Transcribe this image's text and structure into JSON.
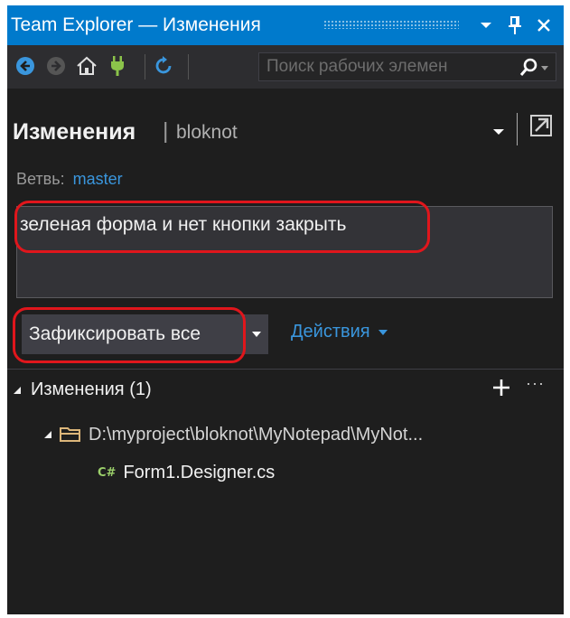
{
  "titlebar": {
    "title": "Team Explorer — Изменения",
    "icons": [
      "dropdown-icon",
      "pin-icon",
      "close-icon"
    ]
  },
  "toolbar": {
    "icons": [
      "back-icon",
      "forward-icon",
      "home-icon",
      "connect-icon",
      "refresh-icon"
    ],
    "search_placeholder": "Поиск рабочих элемен",
    "search_icon": "search-icon"
  },
  "header": {
    "title": "Изменения",
    "separator": "|",
    "repo": "bloknot"
  },
  "branch": {
    "label": "Ветвь:",
    "value": "master"
  },
  "commit": {
    "message": "зеленая форма и нет кнопки закрыть",
    "button_label": "Зафиксировать все",
    "actions_label": "Действия"
  },
  "changes": {
    "header": "Изменения (1)",
    "more": "···",
    "folder_path": "D:\\myproject\\bloknot\\MyNotepad\\MyNot...",
    "file_icon_label": "C#",
    "file_name": "Form1.Designer.cs"
  },
  "colors": {
    "accent": "#007acc",
    "link": "#3a96dd",
    "highlight": "#e0161c",
    "background": "#1e1e1e"
  }
}
